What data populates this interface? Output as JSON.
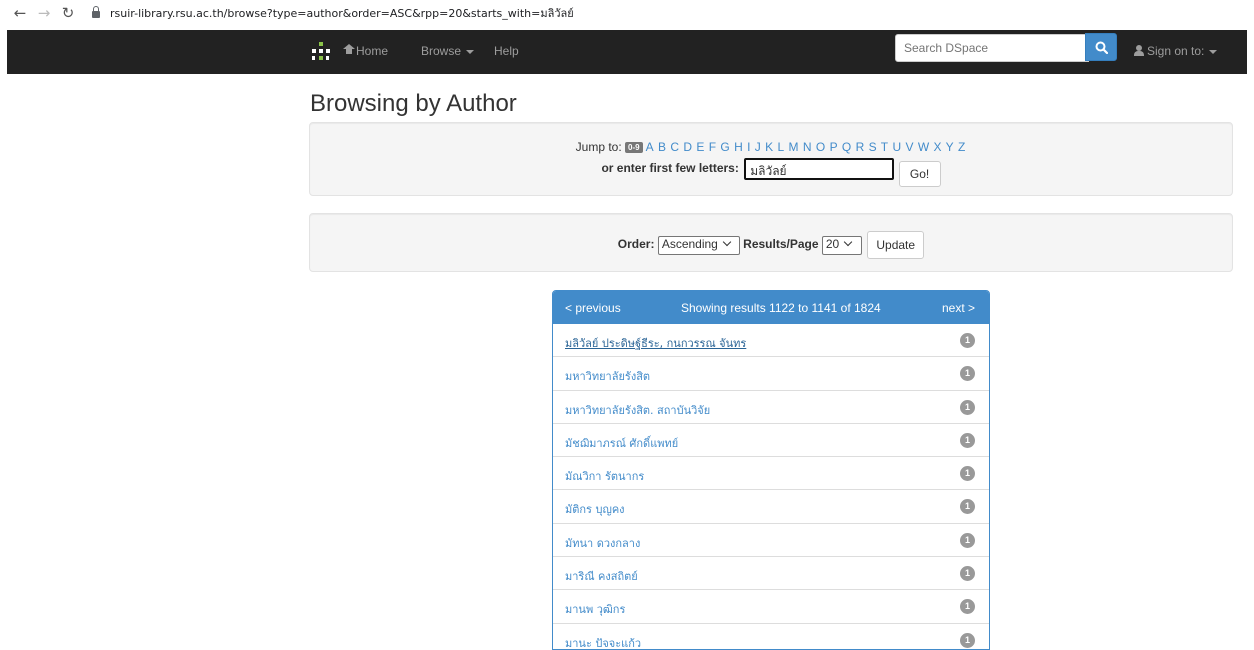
{
  "browser": {
    "url": "rsuir-library.rsu.ac.th/browse?type=author&order=ASC&rpp=20&starts_with=มลิวัลย์"
  },
  "navbar": {
    "home_label": "Home",
    "browse_label": "Browse",
    "help_label": "Help",
    "search_placeholder": "Search DSpace",
    "signon_label": "Sign on to:"
  },
  "page": {
    "title": "Browsing by Author"
  },
  "jump": {
    "label": "Jump to:",
    "badge": "0-9",
    "letters": [
      "A",
      "B",
      "C",
      "D",
      "E",
      "F",
      "G",
      "H",
      "I",
      "J",
      "K",
      "L",
      "M",
      "N",
      "O",
      "P",
      "Q",
      "R",
      "S",
      "T",
      "U",
      "V",
      "W",
      "X",
      "Y",
      "Z"
    ],
    "enter_label": "or enter first few letters:",
    "input_value": "มลิวัลย์",
    "go_label": "Go!"
  },
  "order": {
    "order_label": "Order:",
    "order_value": "Ascending",
    "rpp_label": "Results/Page",
    "rpp_value": "20",
    "update_label": "Update"
  },
  "results": {
    "prev_label": "< previous",
    "status": "Showing results 1122 to 1141 of 1824",
    "next_label": "next >",
    "items": [
      {
        "name": "มลิวัลย์ ประดิษฐ์ธีระ, กนกวรรณ จันทร",
        "count": "1"
      },
      {
        "name": "มหาวิทยาลัยรังสิต",
        "count": "1"
      },
      {
        "name": "มหาวิทยาลัยรังสิต. สถาบันวิจัย",
        "count": "1"
      },
      {
        "name": "มัชฌิมาภรณ์ ศักดิ์แพทย์",
        "count": "1"
      },
      {
        "name": "มัณวิกา รัตนากร",
        "count": "1"
      },
      {
        "name": "มัติกร บุญคง",
        "count": "1"
      },
      {
        "name": "มัทนา ดวงกลาง",
        "count": "1"
      },
      {
        "name": "มาริณี คงสถิตย์",
        "count": "1"
      },
      {
        "name": "มานพ วุฒิกร",
        "count": "1"
      },
      {
        "name": "มานะ ปัจจะแก้ว",
        "count": "1"
      }
    ]
  }
}
